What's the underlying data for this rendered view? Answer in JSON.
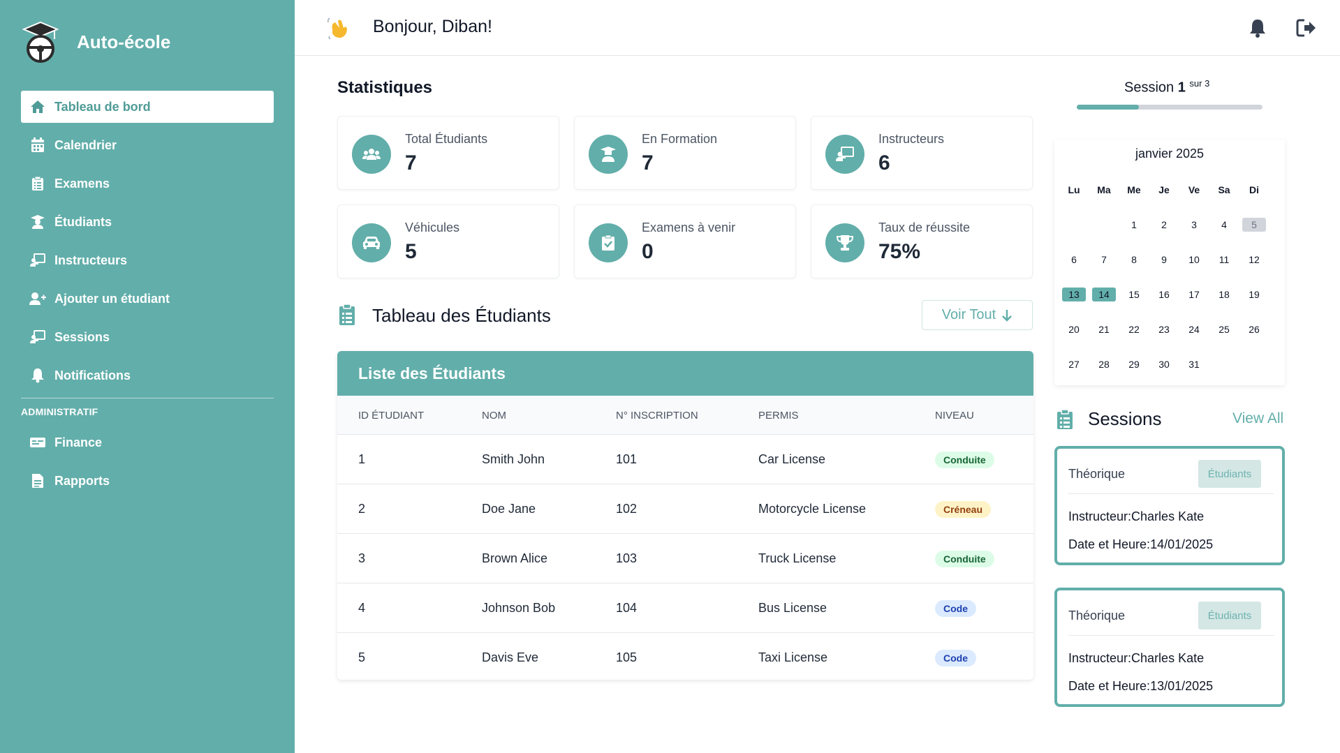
{
  "brand": {
    "name": "Auto-école"
  },
  "sidebar": {
    "items": [
      {
        "label": "Tableau de bord",
        "icon": "home-icon",
        "active": true
      },
      {
        "label": "Calendrier",
        "icon": "calendar-icon"
      },
      {
        "label": "Examens",
        "icon": "clipboard-list-icon"
      },
      {
        "label": "Étudiants",
        "icon": "graduate-icon"
      },
      {
        "label": "Instructeurs",
        "icon": "chalkboard-teacher-icon"
      },
      {
        "label": "Ajouter un étudiant",
        "icon": "user-plus-icon"
      },
      {
        "label": "Sessions",
        "icon": "chalkboard-teacher-icon"
      },
      {
        "label": "Notifications",
        "icon": "bell-icon"
      }
    ],
    "section_label": "ADMINISTRATIF",
    "admin_items": [
      {
        "label": "Finance",
        "icon": "money-check-icon"
      },
      {
        "label": "Rapports",
        "icon": "file-alt-icon"
      }
    ]
  },
  "header": {
    "greeting": "Bonjour, Diban!"
  },
  "stats": {
    "title": "Statistiques",
    "cards": [
      {
        "label": "Total Étudiants",
        "value": "7",
        "icon": "users-icon"
      },
      {
        "label": "En Formation",
        "value": "7",
        "icon": "graduate-icon"
      },
      {
        "label": "Instructeurs",
        "value": "6",
        "icon": "chalkboard-teacher-icon"
      },
      {
        "label": "Véhicules",
        "value": "5",
        "icon": "car-icon"
      },
      {
        "label": "Examens à venir",
        "value": "0",
        "icon": "clipboard-check-icon"
      },
      {
        "label": "Taux de réussite",
        "value": "75%",
        "icon": "trophy-icon"
      }
    ]
  },
  "students_table": {
    "title": "Tableau des Étudiants",
    "view_all_label": "Voir Tout",
    "banner": "Liste des Étudiants",
    "columns": [
      "ID ÉTUDIANT",
      "NOM",
      "N° INSCRIPTION",
      "PERMIS",
      "NIVEAU"
    ],
    "rows": [
      {
        "id": "1",
        "name": "Smith John",
        "inscription": "101",
        "permis": "Car License",
        "niveau": "Conduite",
        "badge": "green"
      },
      {
        "id": "2",
        "name": "Doe Jane",
        "inscription": "102",
        "permis": "Motorcycle License",
        "niveau": "Créneau",
        "badge": "yellow"
      },
      {
        "id": "3",
        "name": "Brown Alice",
        "inscription": "103",
        "permis": "Truck License",
        "niveau": "Conduite",
        "badge": "green"
      },
      {
        "id": "4",
        "name": "Johnson Bob",
        "inscription": "104",
        "permis": "Bus License",
        "niveau": "Code",
        "badge": "blue"
      },
      {
        "id": "5",
        "name": "Davis Eve",
        "inscription": "105",
        "permis": "Taxi License",
        "niveau": "Code",
        "badge": "blue"
      }
    ]
  },
  "session_progress": {
    "prefix": "Session",
    "current": "1",
    "suffix": "sur 3",
    "fraction": 0.333
  },
  "calendar": {
    "month_label": "janvier 2025",
    "weekdays": [
      "Lu",
      "Ma",
      "Me",
      "Je",
      "Ve",
      "Sa",
      "Di"
    ],
    "first_weekday_index": 2,
    "days_in_month": 31,
    "today": 5,
    "selected": [
      13,
      14
    ]
  },
  "sessions": {
    "title": "Sessions",
    "view_all_label": "View All",
    "items": [
      {
        "type": "Théorique",
        "button": "Étudiants",
        "instructor_label": "Instructeur:",
        "instructor": "Charles Kate",
        "date_label": "Date et Heure:",
        "date": "14/01/2025"
      },
      {
        "type": "Théorique",
        "button": "Étudiants",
        "instructor_label": "Instructeur:",
        "instructor": "Charles Kate",
        "date_label": "Date et Heure:",
        "date": "13/01/2025"
      }
    ]
  },
  "colors": {
    "accent": "#62aeaa",
    "sidebar": "#62aeaa"
  }
}
